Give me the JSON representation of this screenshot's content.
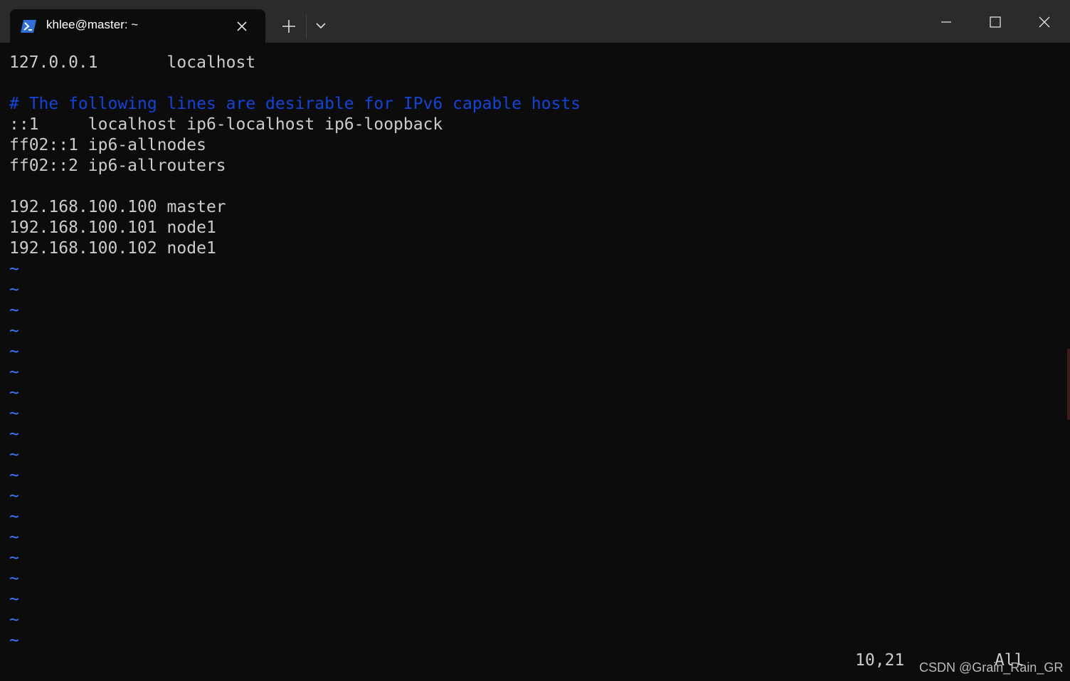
{
  "window": {
    "tab_title": "khlee@master: ~",
    "tab_icon": "powershell-icon",
    "new_tab_icon": "plus-icon",
    "dropdown_icon": "chevron-down-icon",
    "close_tab_icon": "close-icon",
    "minimize_icon": "minimize-icon",
    "maximize_icon": "maximize-icon",
    "close_window_icon": "close-icon"
  },
  "terminal": {
    "line_0": "127.0.0.1       localhost",
    "line_1": "",
    "line_2": "# The following lines are desirable for IPv6 capable hosts",
    "line_3": "::1     localhost ip6-localhost ip6-loopback",
    "line_4": "ff02::1 ip6-allnodes",
    "line_5": "ff02::2 ip6-allrouters",
    "line_6": "",
    "line_7": "192.168.100.100 master",
    "line_8": "192.168.100.101 node1",
    "line_9": "192.168.100.102 node1",
    "empty_marker": "~",
    "cursor_position": "10,21",
    "scroll_status": "All"
  },
  "watermark": "CSDN @Grain_Rain_GR",
  "colors": {
    "background": "#0c0c0c",
    "titlebar": "#2b2b2b",
    "text": "#cccccc",
    "comment": "#1543d6",
    "tilde": "#3b78ff"
  }
}
